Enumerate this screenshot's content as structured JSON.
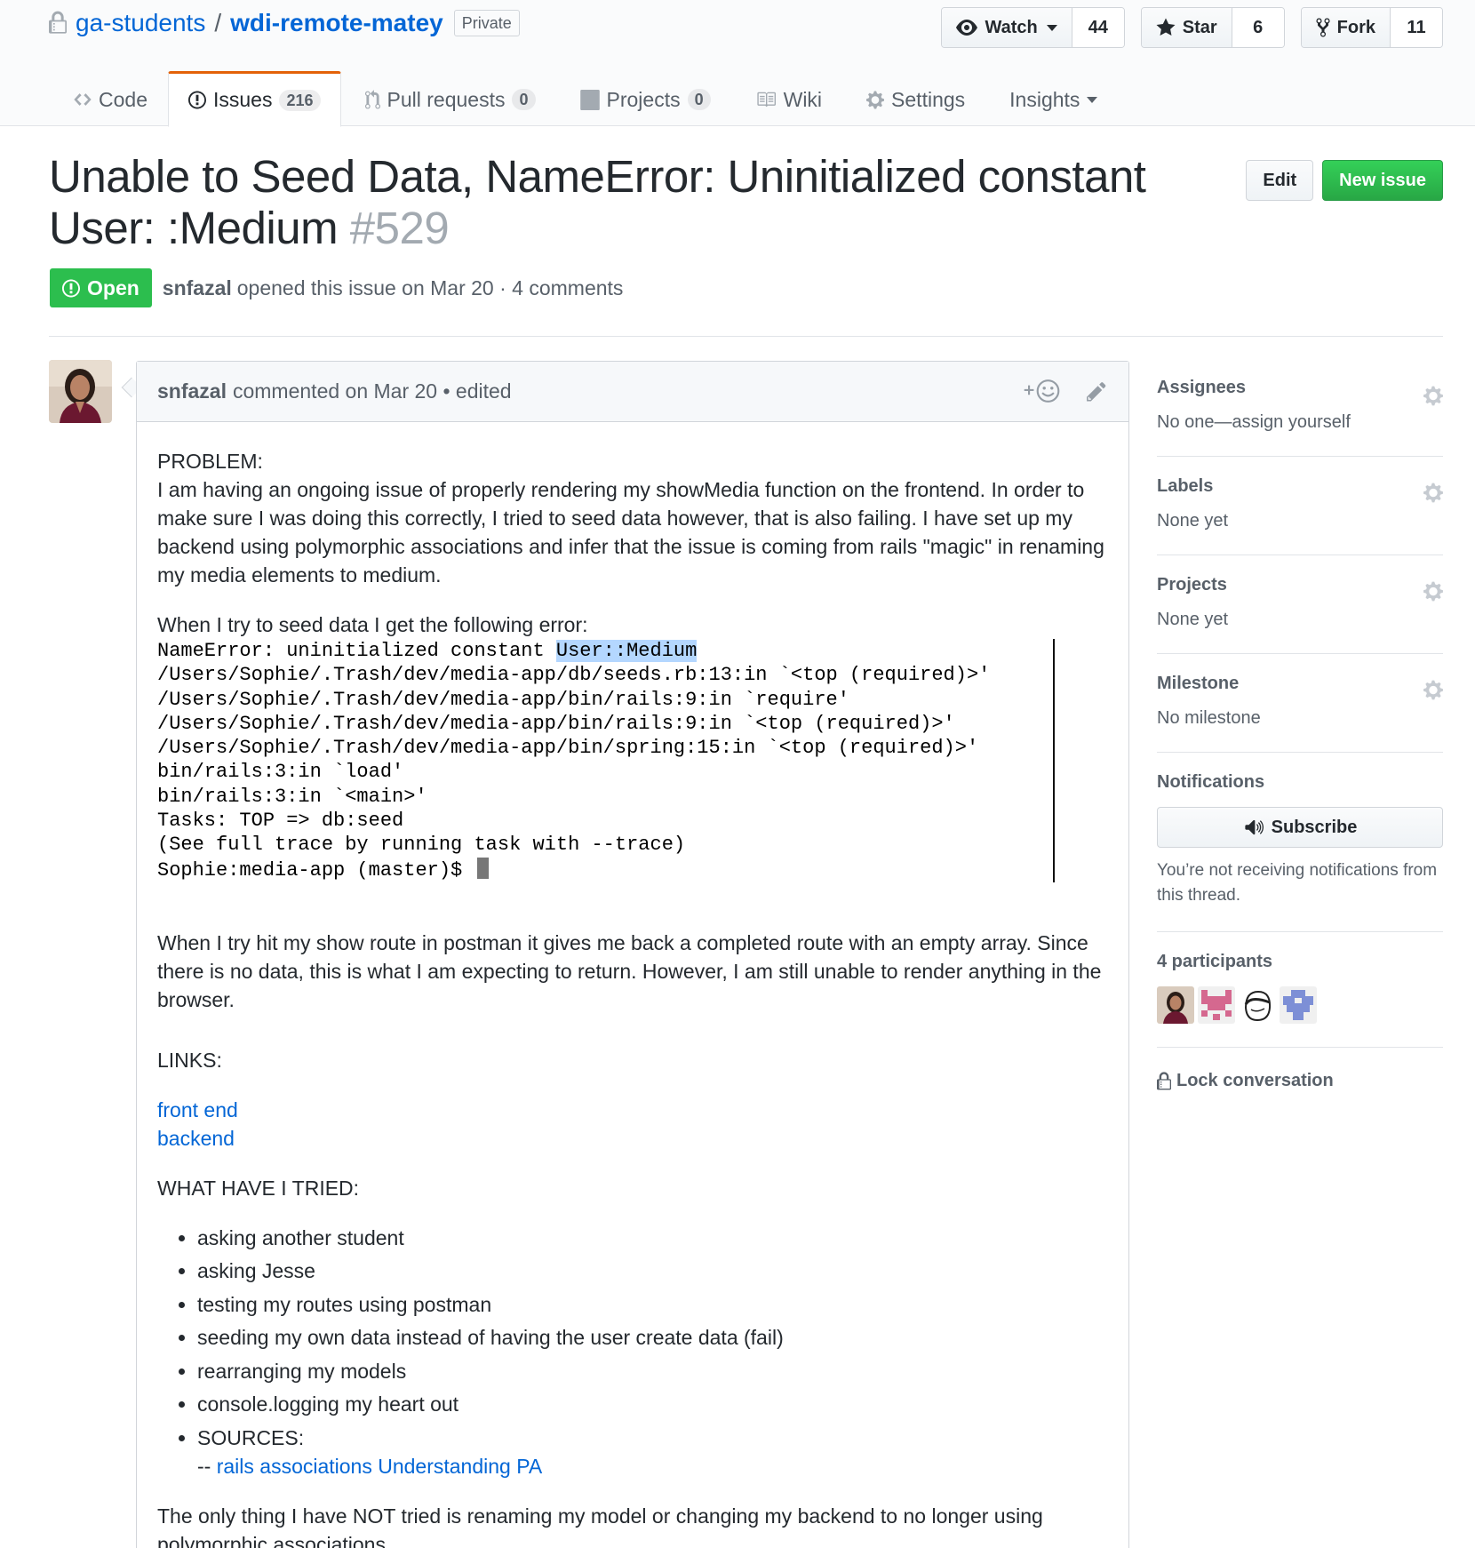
{
  "repo": {
    "owner": "ga-students",
    "separator": "/",
    "name": "wdi-remote-matey",
    "visibility": "Private",
    "actions": {
      "watch": {
        "label": "Watch",
        "count": "44"
      },
      "star": {
        "label": "Star",
        "count": "6"
      },
      "fork": {
        "label": "Fork",
        "count": "11"
      }
    },
    "nav": {
      "code": "Code",
      "issues": {
        "label": "Issues",
        "count": "216"
      },
      "pulls": {
        "label": "Pull requests",
        "count": "0"
      },
      "projects": {
        "label": "Projects",
        "count": "0"
      },
      "wiki": "Wiki",
      "settings": "Settings",
      "insights": "Insights"
    }
  },
  "issue": {
    "title_line1": "Unable to Seed Data, NameError: Uninitialized constant",
    "title_line2": "User: :Medium",
    "number": "#529",
    "state": "Open",
    "author": "snfazal",
    "meta": "opened this issue on Mar 20 · 4 comments",
    "buttons": {
      "edit": "Edit",
      "new_issue": "New issue"
    }
  },
  "comment": {
    "author": "snfazal",
    "meta": "commented on Mar 20 • edited",
    "reaction_icon": "smiley-plus-icon",
    "edit_icon": "pencil-icon",
    "problem_heading": "PROBLEM:",
    "problem_text": "I am having an ongoing issue of properly rendering my showMedia function on the frontend. In order to make sure I was doing this correctly, I tried to seed data however, that is also failing. I have set up my backend using polymorphic associations and infer that the issue is coming from rails \"magic\" in renaming my media elements to medium.",
    "seed_intro": "When I try to seed data I get the following error:",
    "terminal": {
      "line1_prefix": "NameError: uninitialized constant ",
      "line1_highlight": "User::Medium",
      "line2": "/Users/Sophie/.Trash/dev/media-app/db/seeds.rb:13:in `<top (required)>'",
      "line3": "/Users/Sophie/.Trash/dev/media-app/bin/rails:9:in `require'",
      "line4": "/Users/Sophie/.Trash/dev/media-app/bin/rails:9:in `<top (required)>'",
      "line5": "/Users/Sophie/.Trash/dev/media-app/bin/spring:15:in `<top (required)>'",
      "line6": "bin/rails:3:in `load'",
      "line7": "bin/rails:3:in `<main>'",
      "line8": "Tasks: TOP => db:seed",
      "line9": "(See full trace by running task with --trace)",
      "line10": "Sophie:media-app (master)$"
    },
    "postman_text": "When I try hit my show route in postman it gives me back a completed route with an empty array. Since there is no data, this is what I am expecting to return. However, I am still unable to render anything in the browser.",
    "links_heading": "LINKS:",
    "links": [
      "front end",
      "backend"
    ],
    "tried_heading": "WHAT HAVE I TRIED:",
    "tried": [
      "asking another student",
      "asking Jesse",
      "testing my routes using postman",
      "seeding my own data instead of having the user create data (fail)",
      "rearranging my models",
      "console.logging my heart out",
      "SOURCES:"
    ],
    "sources_prefix": "-- ",
    "sources_link": "rails associations Understanding PA",
    "closing": "The only thing I have NOT tried is renaming my model or changing my backend to no longer using polymorphic associations."
  },
  "sidebar": {
    "assignees": {
      "heading": "Assignees",
      "value": "No one—assign yourself"
    },
    "labels": {
      "heading": "Labels",
      "value": "None yet"
    },
    "projects": {
      "heading": "Projects",
      "value": "None yet"
    },
    "milestone": {
      "heading": "Milestone",
      "value": "No milestone"
    },
    "notifications": {
      "heading": "Notifications",
      "button": "Subscribe",
      "note": "You’re not receiving notifications from this thread."
    },
    "participants": {
      "heading": "4 participants"
    },
    "lock": "Lock conversation"
  },
  "colors": {
    "link": "#0366d6",
    "open_green": "#2cbe4e",
    "new_issue_green": "#28a745",
    "tab_accent": "#e36209",
    "highlight": "#b4d7ff"
  }
}
